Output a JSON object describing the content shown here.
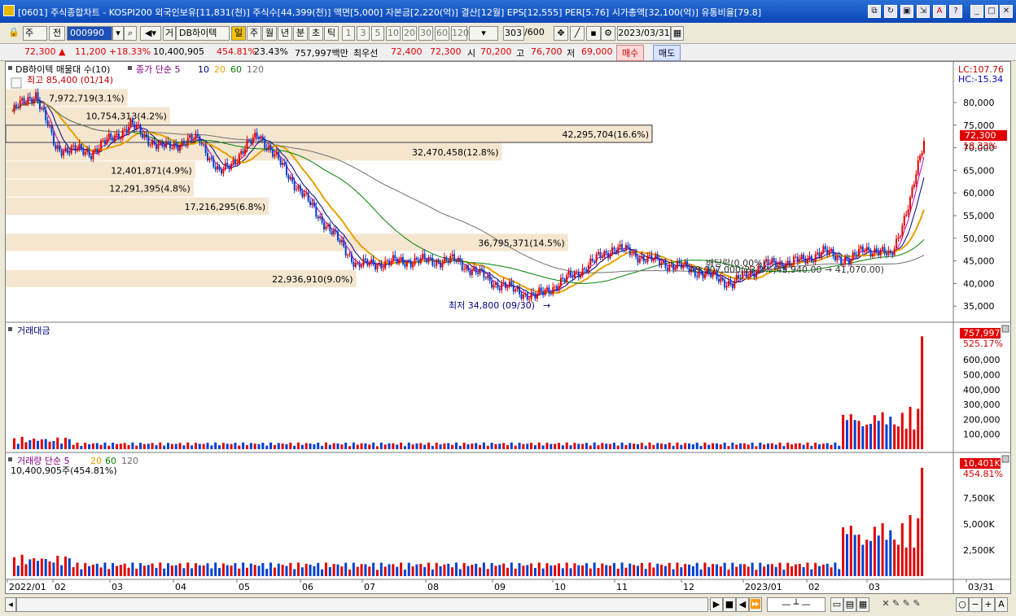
{
  "window": {
    "title": "[0601] 주식종합차트 - KOSPI200 외국인보유[11,831(천)] 주식수[44,399(천)] 액면[5,000] 자본금[2,220(억)] 결산[12월] EPS[12,555] PER[5.76] 시가총액[32,100(억)] 유통비율[79.8]"
  },
  "toolbar": {
    "period_select": "주",
    "prev_label": "전",
    "code_value": "000990",
    "group_label": "거",
    "stock_name": "DB하이텍",
    "period_tabs": [
      "일",
      "주",
      "월",
      "년",
      "분",
      "초",
      "틱"
    ],
    "active_tab": "일",
    "num_buttons": [
      "1",
      "3",
      "5",
      "10",
      "20",
      "30",
      "60",
      "120"
    ],
    "count_value": "303",
    "count_total": "/600",
    "date_value": "2023/03/31"
  },
  "pricebar": {
    "price": "72,300",
    "change": "11,200",
    "change_pct": "+18.33%",
    "volume": "10,400,905",
    "vol_ratio": "454.81%",
    "turnover": "23.43%",
    "amount": "757,997백만",
    "best_ask_label": "최우선",
    "best_ask": "72,400",
    "best_bid": "72,300",
    "open_label": "시",
    "open": "70,200",
    "high_label": "고",
    "high": "76,700",
    "low_label": "저",
    "low": "69,000",
    "buy_label": "매수",
    "sell_label": "매도"
  },
  "price_panel": {
    "legend_name": "DB하이텍 매물대 수(10)",
    "legend_ma": "종가 단순 5",
    "ma_periods": [
      "10",
      "20",
      "60",
      "120"
    ],
    "ma_colors": [
      "#000080",
      "#e8a000",
      "#008000",
      "#707070"
    ],
    "lc_label": "LC:107.76",
    "hc_label": "HC:-15.34",
    "current_badge": "72,300",
    "current_pct": "18.33%",
    "high_note": "최고 85,400 (01/14)",
    "low_note": "최저 34,800 (09/30)",
    "dividend_note": "배당락(0.00%)",
    "annotation_row": "49,007,000(23.2%)45,940.00 → 41,070.00)",
    "axis_ticks": [
      "80,000",
      "75,000",
      "70,000",
      "65,000",
      "60,000",
      "55,000",
      "50,000",
      "45,000",
      "40,000",
      "35,000"
    ],
    "volume_profile": [
      {
        "label": "7,972,719(3.1%)",
        "price": 81000,
        "volume": 7972719
      },
      {
        "label": "10,754,313(4.2%)",
        "price": 77000,
        "volume": 10754313
      },
      {
        "label": "42,295,704(16.6%)",
        "price": 73000,
        "volume": 42295704
      },
      {
        "label": "32,470,458(12.8%)",
        "price": 69000,
        "volume": 32470458
      },
      {
        "label": "12,401,871(4.9%)",
        "price": 65000,
        "volume": 12401871
      },
      {
        "label": "12,291,395(4.8%)",
        "price": 61000,
        "volume": 12291395
      },
      {
        "label": "17,216,295(6.8%)",
        "price": 57000,
        "volume": 17216295
      },
      {
        "label": "36,795,371(14.5%)",
        "price": 49000,
        "volume": 36795371
      },
      {
        "label": "22,936,910(9.0%)",
        "price": 41000,
        "volume": 22936910
      }
    ]
  },
  "amount_panel": {
    "legend": "거래대금",
    "badge": "757,997",
    "pct": "525.17%",
    "axis_ticks": [
      "600,000",
      "500,000",
      "400,000",
      "300,000",
      "200,000",
      "100,000"
    ]
  },
  "volume_panel": {
    "legend": "거래량 단순 5",
    "ma_periods": [
      "20",
      "60",
      "120"
    ],
    "sub_legend": "10,400,905주(454.81%)",
    "badge": "10,401K",
    "pct": "454.81%",
    "axis_ticks": [
      "7,500K",
      "5,000K",
      "2,500K"
    ]
  },
  "x_axis": {
    "labels": [
      "2022/01",
      "02",
      "03",
      "04",
      "05",
      "06",
      "07",
      "08",
      "09",
      "10",
      "11",
      "12",
      "2023/01",
      "02",
      "03",
      "03/31"
    ]
  },
  "colors": {
    "up": "#e00000",
    "down": "#0040d0",
    "profile": "#f5e6d0",
    "badge": "#e00000"
  }
}
